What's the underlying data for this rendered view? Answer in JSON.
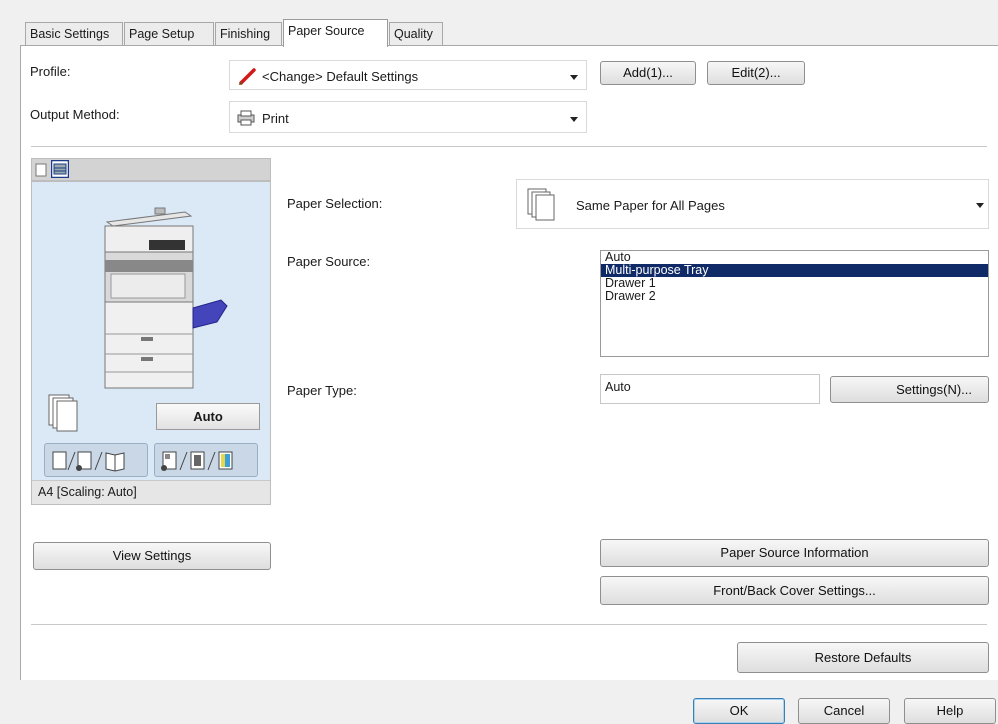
{
  "tabs": [
    {
      "label": "Basic Settings"
    },
    {
      "label": "Page Setup"
    },
    {
      "label": "Finishing"
    },
    {
      "label": "Paper Source"
    },
    {
      "label": "Quality"
    }
  ],
  "profile": {
    "label": "Profile:",
    "value": "<Change> Default Settings",
    "add_label": "Add(1)...",
    "edit_label": "Edit(2)..."
  },
  "output_method": {
    "label": "Output Method:",
    "value": "Print"
  },
  "preview": {
    "auto_label": "Auto",
    "footer": "A4 [Scaling: Auto]"
  },
  "paper_selection": {
    "label": "Paper Selection:",
    "value": "Same Paper for All Pages"
  },
  "paper_source": {
    "label": "Paper Source:",
    "items": [
      "Auto",
      "Multi-purpose Tray",
      "Drawer 1",
      "Drawer 2"
    ],
    "selected": "Multi-purpose Tray"
  },
  "paper_type": {
    "label": "Paper Type:",
    "value": "Auto",
    "settings_label": "Settings(N)..."
  },
  "buttons": {
    "view_settings": "View Settings",
    "paper_source_info": "Paper Source Information",
    "cover_settings": "Front/Back Cover Settings...",
    "restore_defaults": "Restore Defaults",
    "ok": "OK",
    "cancel": "Cancel",
    "help": "Help"
  },
  "colors": {
    "selection": "#0f2a66",
    "preview_bg": "#dbe9f6"
  }
}
